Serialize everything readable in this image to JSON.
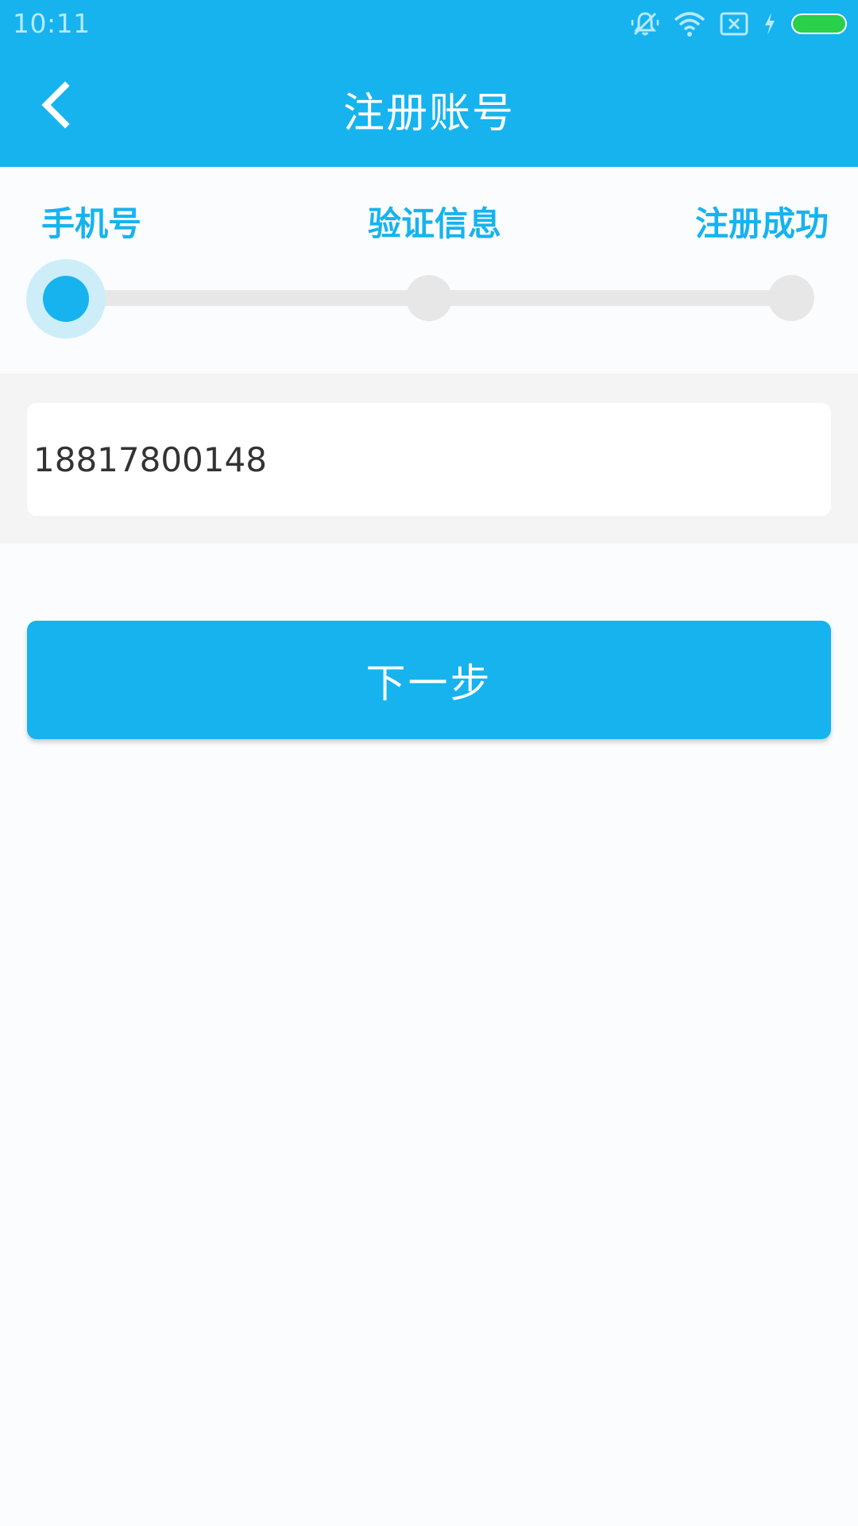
{
  "status_bar": {
    "time": "10:11",
    "icons": [
      "mute-notifications-icon",
      "wifi-icon",
      "no-sim-icon",
      "charging-icon",
      "battery-icon"
    ],
    "battery_color": "#2ad04a"
  },
  "header": {
    "title": "注册账号",
    "back_icon": "chevron-left-icon",
    "background_color": "#16b3ef"
  },
  "steps": {
    "current_index": 0,
    "items": [
      {
        "label": "手机号"
      },
      {
        "label": "验证信息"
      },
      {
        "label": "注册成功"
      }
    ],
    "active_color": "#16b3ef",
    "inactive_color": "#e7e7e7"
  },
  "form": {
    "phone_value": "18817800148"
  },
  "actions": {
    "next_label": "下一步"
  }
}
